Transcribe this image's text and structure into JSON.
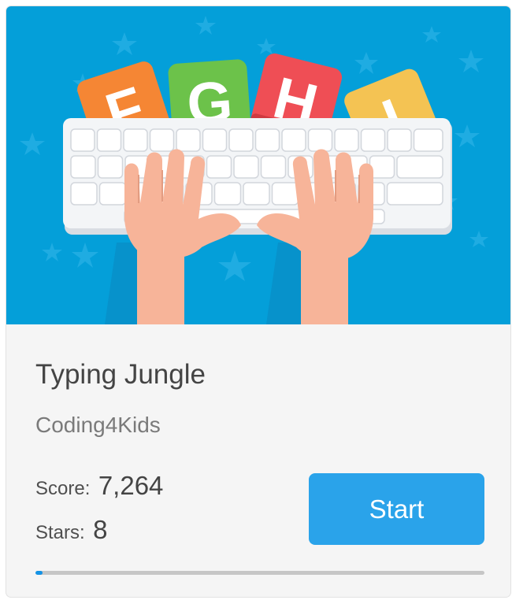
{
  "game": {
    "title": "Typing Jungle",
    "author": "Coding4Kids",
    "banner_letters": [
      "F",
      "G",
      "H",
      "I"
    ],
    "score_label": "Score:",
    "score_value": "7,264",
    "stars_label": "Stars:",
    "stars_value": "8",
    "start_label": "Start",
    "progress": 0.015
  },
  "colors": {
    "banner_bg": "#049fd9",
    "block_orange": "#f58634",
    "block_green": "#6cc24a",
    "block_red": "#ef4e55",
    "block_yellow": "#f4c353",
    "button": "#2aa3ea",
    "progress_fill": "#1493e6",
    "skin": "#f7b499"
  }
}
